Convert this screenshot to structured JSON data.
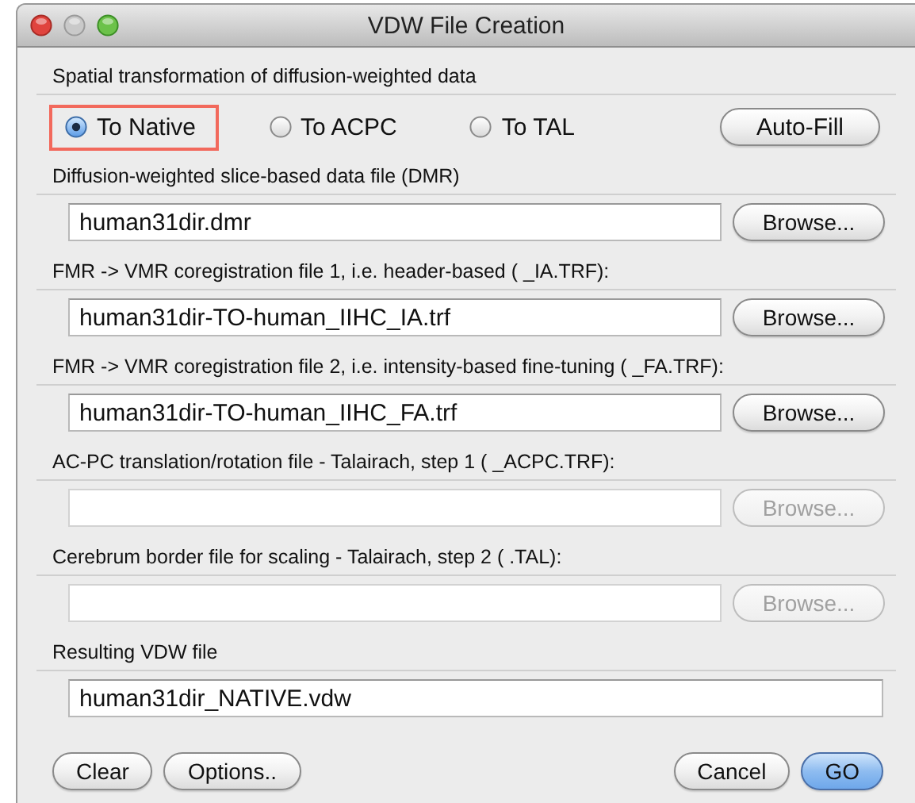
{
  "window": {
    "title": "VDW File Creation"
  },
  "transformation": {
    "label": "Spatial transformation of diffusion-weighted data",
    "options": [
      {
        "label": "To Native",
        "selected": true,
        "highlighted": true
      },
      {
        "label": "To ACPC",
        "selected": false,
        "highlighted": false
      },
      {
        "label": "To TAL",
        "selected": false,
        "highlighted": false
      }
    ],
    "auto_fill": "Auto-Fill"
  },
  "files": [
    {
      "label": "Diffusion-weighted slice-based data file (DMR)",
      "value": "human31dir.dmr",
      "browse": "Browse...",
      "disabled": false
    },
    {
      "label": "FMR -> VMR coregistration file 1, i.e. header-based ( _IA.TRF):",
      "value": "human31dir-TO-human_IIHC_IA.trf",
      "browse": "Browse...",
      "disabled": false
    },
    {
      "label": "FMR -> VMR coregistration file 2, i.e. intensity-based fine-tuning ( _FA.TRF):",
      "value": "human31dir-TO-human_IIHC_FA.trf",
      "browse": "Browse...",
      "disabled": false
    },
    {
      "label": "AC-PC translation/rotation file - Talairach, step 1 ( _ACPC.TRF):",
      "browse": "Browse...",
      "disabled": true
    },
    {
      "label": "Cerebrum border file for scaling - Talairach, step 2 ( .TAL):",
      "browse": "Browse...",
      "disabled": true
    }
  ],
  "result": {
    "label": "Resulting VDW file",
    "value": "human31dir_NATIVE.vdw"
  },
  "left_buttons": [
    {
      "label": "Clear",
      "is_default": false
    },
    {
      "label": "Options..",
      "is_default": false
    }
  ],
  "right_buttons": [
    {
      "label": "Cancel",
      "is_default": false
    },
    {
      "label": "GO",
      "is_default": true
    }
  ]
}
